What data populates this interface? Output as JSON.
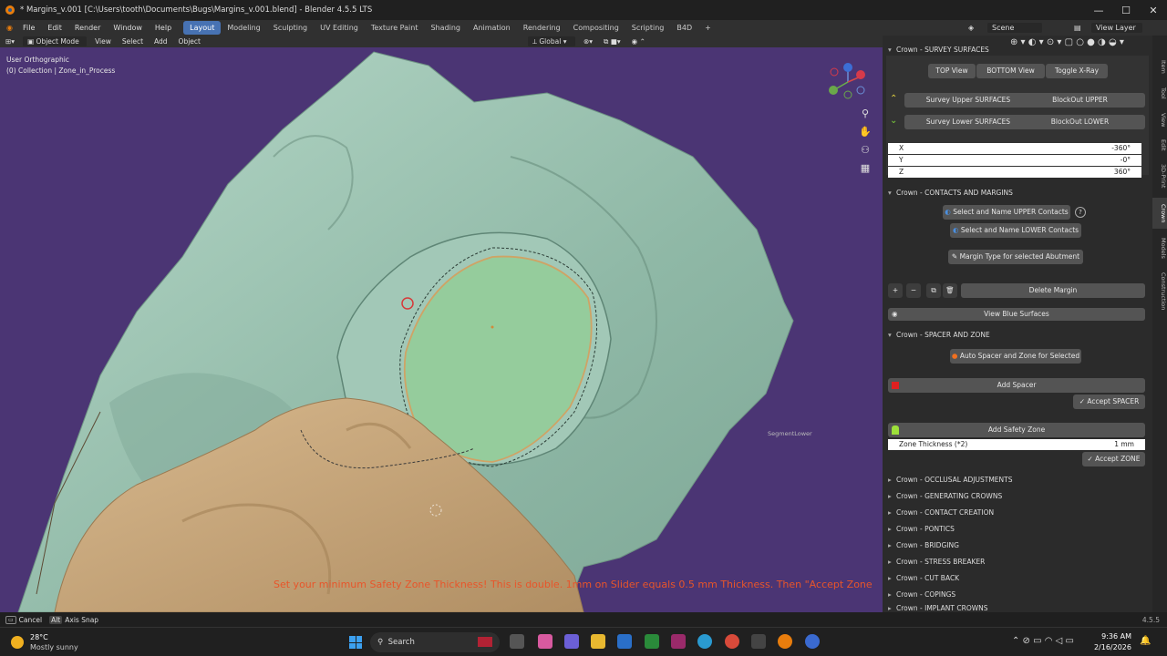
{
  "window": {
    "title": "* Margins_v.001 [C:\\Users\\tooth\\Documents\\Bugs\\Margins_v.001.blend] - Blender 4.5.5 LTS"
  },
  "menu": [
    "File",
    "Edit",
    "Render",
    "Window",
    "Help"
  ],
  "workspaces": [
    "Layout",
    "Modeling",
    "Sculpting",
    "UV Editing",
    "Texture Paint",
    "Shading",
    "Animation",
    "Rendering",
    "Compositing",
    "Scripting",
    "B4D"
  ],
  "scene": {
    "scene_label": "Scene",
    "view_layer_label": "View Layer"
  },
  "header": {
    "mode": "Object Mode",
    "view": "View",
    "select": "Select",
    "add": "Add",
    "object": "Object",
    "transform": "Global"
  },
  "viewport": {
    "view_name": "User Orthographic",
    "collection": "(0) Collection | Zone_in_Process",
    "object_label": "SegmentLower",
    "overlay_message": "Set your minimum Safety Zone Thickness! This is double. 1mm on Slider equals 0.5 mm Thickness. Then \"Accept Zone"
  },
  "sidebar_tabs": [
    "Item",
    "Tool",
    "View",
    "Edit",
    "3D-Print",
    "Crown",
    "Models",
    "Construction"
  ],
  "survey": {
    "header": "Crown - SURVEY SURFACES",
    "top_view": "TOP View",
    "bottom_view": "BOTTOM View",
    "toggle_xray": "Toggle X-Ray",
    "survey_upper": "Survey Upper SURFACES",
    "blockout_upper": "BlockOut UPPER",
    "survey_lower": "Survey Lower SURFACES",
    "blockout_lower": "BlockOut LOWER",
    "x_label": "X",
    "x_value": "-360°",
    "y_label": "Y",
    "y_value": "-0°",
    "z_label": "Z",
    "z_value": "360°"
  },
  "contacts": {
    "header": "Crown - CONTACTS AND MARGINS",
    "select_upper": "Select and Name UPPER Contacts",
    "select_lower": "Select and Name LOWER Contacts",
    "margin_type": "Margin Type for selected Abutment",
    "delete_margin": "Delete Margin",
    "view_blue": "View Blue Surfaces"
  },
  "spacer": {
    "header": "Crown - SPACER AND ZONE",
    "auto_spacer": "Auto Spacer and Zone for Selected",
    "add_spacer": "Add Spacer",
    "accept_spacer": "Accept SPACER",
    "add_zone": "Add Safety Zone",
    "zone_label": "Zone Thickness (*2)",
    "zone_value": "1 mm",
    "accept_zone": "Accept ZONE"
  },
  "collapsed_panels": [
    "Crown - OCCLUSAL ADJUSTMENTS",
    "Crown - GENERATING CROWNS",
    "Crown - CONTACT CREATION",
    "Crown - PONTICS",
    "Crown - BRIDGING",
    "Crown - STRESS BREAKER",
    "Crown - CUT BACK",
    "Crown - COPINGS",
    "Crown - IMPLANT CROWNS"
  ],
  "status": {
    "cancel": "Cancel",
    "alt": "Alt",
    "axis_snap": "Axis Snap",
    "version": "4.5.5"
  },
  "taskbar": {
    "temp": "28°C",
    "weather": "Mostly sunny",
    "search": "Search",
    "time": "9:36 AM",
    "date": "2/16/2026"
  },
  "colors": {
    "accent": "#4772b3",
    "viewport_bg": "#4b3574",
    "model_green": "#9cc3b3",
    "model_tan": "#c9a77e",
    "zone_green": "#8fcf8f",
    "margin_orange": "#e8903a",
    "overlay_text": "#e8552a"
  }
}
